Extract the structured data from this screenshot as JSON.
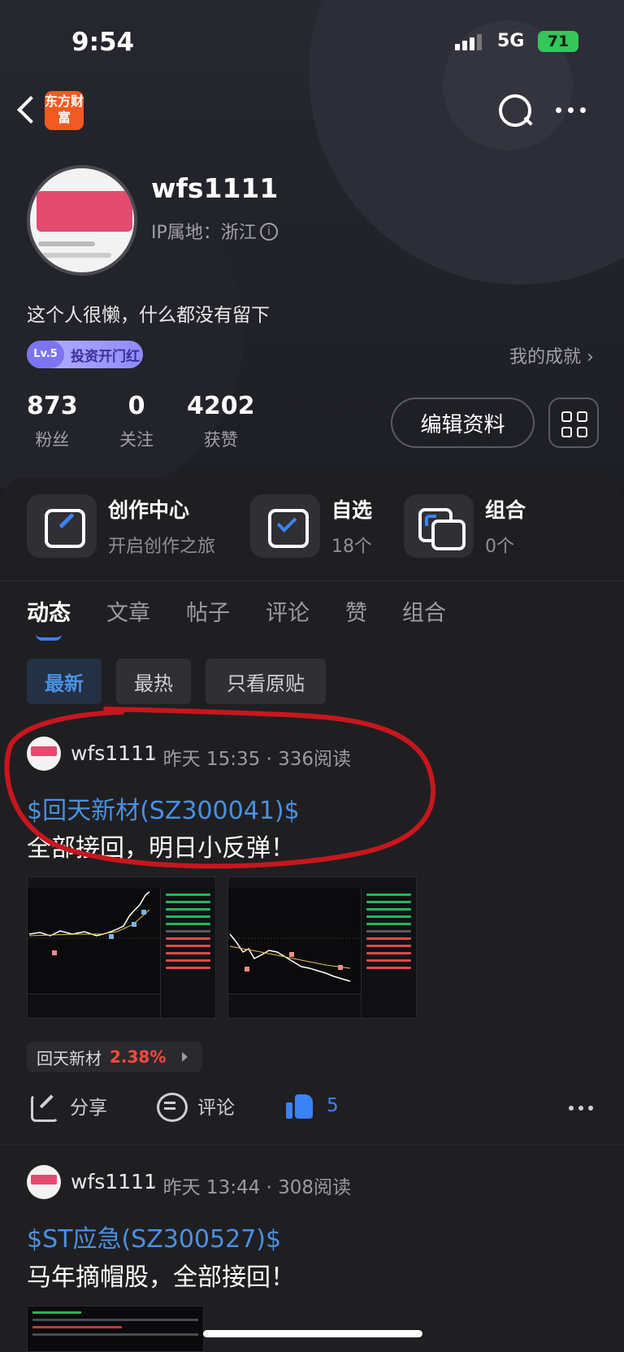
{
  "status_bar": {
    "time": "9:54",
    "network": "5G",
    "battery": "71"
  },
  "nav": {
    "logo_text": "东方财富"
  },
  "profile": {
    "username": "wfs1111",
    "ip_location": "IP属地：浙江",
    "bio": "这个人很懒，什么都没有留下",
    "level": "Lv.5",
    "level_title": "投资开门红",
    "achievements_link": "我的成就 ›",
    "stats": [
      {
        "value": "873",
        "label": "粉丝"
      },
      {
        "value": "0",
        "label": "关注"
      },
      {
        "value": "4202",
        "label": "获赞"
      }
    ],
    "edit_button": "编辑资料"
  },
  "features": [
    {
      "title": "创作中心",
      "subtitle": "开启创作之旅",
      "icon": "create-icon"
    },
    {
      "title": "自选",
      "subtitle": "18个",
      "icon": "watchlist-icon"
    },
    {
      "title": "组合",
      "subtitle": "0个",
      "icon": "portfolio-icon"
    }
  ],
  "tabs": [
    {
      "label": "动态",
      "active": true
    },
    {
      "label": "文章",
      "active": false
    },
    {
      "label": "帖子",
      "active": false
    },
    {
      "label": "评论",
      "active": false
    },
    {
      "label": "赞",
      "active": false
    },
    {
      "label": "组合",
      "active": false
    }
  ],
  "filters": [
    {
      "label": "最新",
      "active": true
    },
    {
      "label": "最热",
      "active": false
    },
    {
      "label": "只看原贴",
      "active": false
    }
  ],
  "posts": [
    {
      "user": "wfs1111",
      "meta": "· 昨天 15:35 · 336阅读",
      "stock": "$回天新材(SZ300041)$",
      "text": "全部接回，明日小反弹！",
      "tag_name": "回天新材",
      "tag_change": "2.38%",
      "actions": {
        "share": "分享",
        "comment": "评论",
        "likes": "5"
      }
    },
    {
      "user": "wfs1111",
      "meta": "· 昨天 13:44 · 308阅读",
      "stock": "$ST应急(SZ300527)$",
      "text": "马年摘帽股，全部接回！"
    }
  ],
  "colors": {
    "accent_blue": "#3b82f6",
    "stock_link": "#4a90e2",
    "up_red": "#ff4a3d",
    "annotation_red": "#c8161d"
  }
}
